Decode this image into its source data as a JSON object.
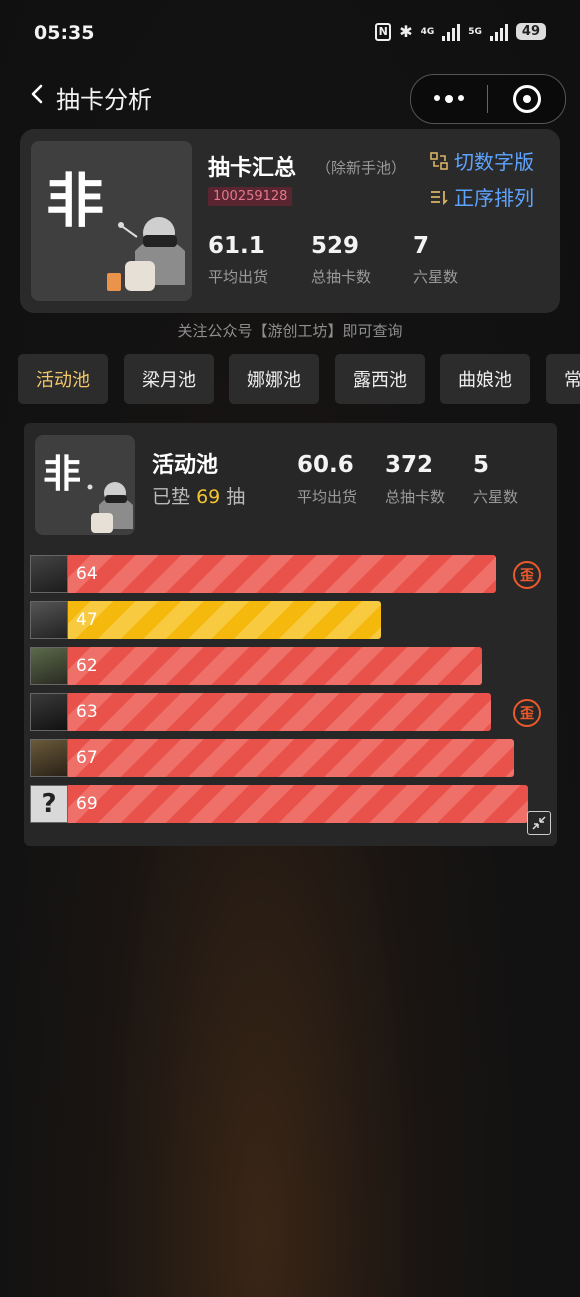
{
  "status_bar": {
    "time": "05:35",
    "net1": "4G",
    "net2": "5G",
    "battery": "49"
  },
  "nav": {
    "title": "抽卡分析"
  },
  "summary": {
    "avatar_char": "非",
    "title": "抽卡汇总",
    "subtitle": "（除新手池）",
    "uid": "100259128",
    "action1": "切数字版",
    "action2": "正序排列",
    "stats": [
      {
        "value": "61.1",
        "label": "平均出货"
      },
      {
        "value": "529",
        "label": "总抽卡数"
      },
      {
        "value": "7",
        "label": "六星数"
      }
    ]
  },
  "notice": "关注公众号【游创工坊】即可查询",
  "tabs": [
    {
      "label": "活动池",
      "active": true
    },
    {
      "label": "梁月池",
      "active": false
    },
    {
      "label": "娜娜池",
      "active": false
    },
    {
      "label": "露西池",
      "active": false
    },
    {
      "label": "曲娘池",
      "active": false
    },
    {
      "label": "常",
      "active": false
    }
  ],
  "pool": {
    "avatar_char": "非",
    "title": "活动池",
    "sub_prefix": "已垫",
    "pity": "69",
    "sub_suffix": "抽",
    "stats": [
      {
        "value": "60.6",
        "label": "平均出货"
      },
      {
        "value": "372",
        "label": "总抽卡数"
      },
      {
        "value": "5",
        "label": "六星数"
      }
    ],
    "wai_label": "歪",
    "unknown_mark": "?",
    "bars": [
      {
        "value": 64,
        "label": "64",
        "color": "red",
        "fill": 0.93,
        "off_rate": true
      },
      {
        "value": 47,
        "label": "47",
        "color": "gold",
        "fill": 0.68,
        "off_rate": false
      },
      {
        "value": 62,
        "label": "62",
        "color": "red",
        "fill": 0.9,
        "off_rate": false
      },
      {
        "value": 63,
        "label": "63",
        "color": "red",
        "fill": 0.92,
        "off_rate": true
      },
      {
        "value": 67,
        "label": "67",
        "color": "red",
        "fill": 0.97,
        "off_rate": false
      },
      {
        "value": 69,
        "label": "69",
        "color": "red",
        "fill": 1.0,
        "off_rate": false
      }
    ]
  }
}
